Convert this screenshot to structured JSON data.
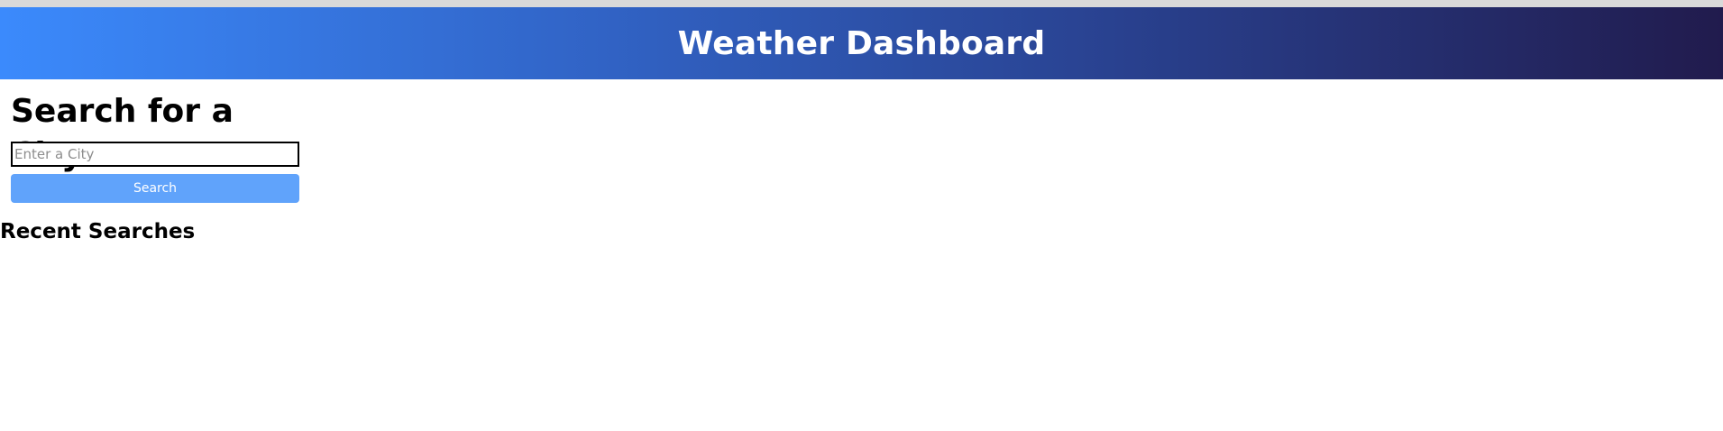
{
  "header": {
    "title": "Weather Dashboard"
  },
  "search": {
    "heading": "Search for a City:",
    "input_value": "",
    "placeholder": "Enter a City",
    "button_label": "Search"
  },
  "recent": {
    "heading": "Recent Searches",
    "items": []
  },
  "colors": {
    "header_gradient_start": "#3b8afc",
    "header_gradient_end": "#211b4d",
    "button_bg": "#60a3fb",
    "button_text": "#ffffff"
  }
}
